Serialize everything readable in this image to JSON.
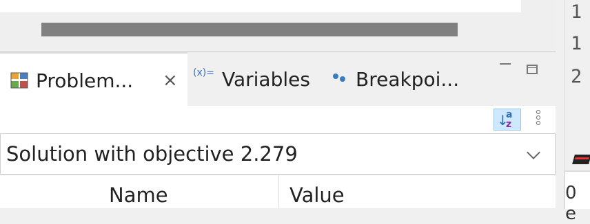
{
  "editor": {
    "line_numbers": [
      "1",
      "1",
      "2"
    ]
  },
  "tabs": [
    {
      "label": "Problem...",
      "icon": "problem-view-icon",
      "close": "×",
      "active": true
    },
    {
      "label": "Variables",
      "icon_text": "(x)=",
      "icon": "variables-icon",
      "active": false
    },
    {
      "label": "Breakpoi...",
      "icon": "breakpoints-icon",
      "active": false
    }
  ],
  "toolbar": {
    "sort_icon": "sort-az-icon",
    "menu_icon": "view-menu-icon"
  },
  "combo": {
    "value": "Solution with objective 2.279"
  },
  "table": {
    "columns": [
      "Name",
      "Value"
    ]
  },
  "right_panel": {
    "partial_text": "0 e"
  },
  "colors": {
    "active_tab": "#ffffff",
    "scrollbar": "#808080",
    "accent": "#2d6eb5"
  }
}
